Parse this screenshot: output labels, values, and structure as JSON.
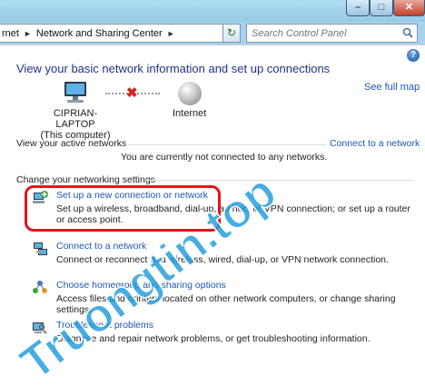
{
  "window": {
    "controls": {
      "minimize": "–",
      "maximize": "□",
      "close": "✕"
    }
  },
  "address": {
    "crumbs": [
      "rnet",
      "Network and Sharing Center"
    ],
    "separator": "►",
    "dropdown": "▼",
    "refresh": "↻"
  },
  "search": {
    "placeholder": "Search Control Panel"
  },
  "help": {
    "label": "?"
  },
  "main": {
    "heading": "View your basic network information and set up connections",
    "see_full_map": "See full map",
    "computer_name": "CIPRIAN-LAPTOP",
    "computer_sub": "(This computer)",
    "internet": "Internet",
    "status_x": "✖",
    "active_networks_label": "View your active networks",
    "connect_link": "Connect to a network",
    "no_connection": "You are currently not connected to any networks.",
    "change_settings_label": "Change your networking settings"
  },
  "tasks": [
    {
      "title": "Set up a new connection or network",
      "desc": "Set up a wireless, broadband, dial-up, ad hoc, or VPN connection; or set up a router or access point."
    },
    {
      "title": "Connect to a network",
      "desc": "Connect or reconnect to a wireless, wired, dial-up, or VPN network connection."
    },
    {
      "title": "Choose homegroup and sharing options",
      "desc": "Access files and printers located on other network computers, or change sharing settings."
    },
    {
      "title": "Troubleshoot problems",
      "desc": "Diagnose and repair network problems, or get troubleshooting information."
    }
  ],
  "watermark": {
    "text": "Truongtin.top"
  },
  "colors": {
    "link": "#1f56b5",
    "heading": "#1e3287",
    "highlight": "#e2141c",
    "watermark": "#1e9bdc"
  }
}
